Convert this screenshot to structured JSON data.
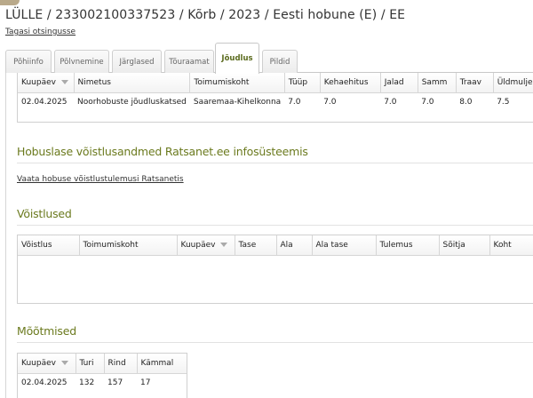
{
  "header": {
    "title": "LÜLLE / 233002100337523 / Kõrb / 2023 / Eesti hobune (E) / EE",
    "back_link": "Tagasi otsingusse"
  },
  "tabs": [
    {
      "label": "Põhiinfo",
      "active": false
    },
    {
      "label": "Põlvnemine",
      "active": false
    },
    {
      "label": "Järglased",
      "active": false
    },
    {
      "label": "Tõuraamat",
      "active": false
    },
    {
      "label": "Jõudlus",
      "active": true
    },
    {
      "label": "Pildid",
      "active": false
    }
  ],
  "performance": {
    "columns": [
      "Kuupäev",
      "Nimetus",
      "Toimumiskoht",
      "Tüüp",
      "Kehaehitus",
      "Jalad",
      "Samm",
      "Traav",
      "Üldmulje"
    ],
    "rows": [
      [
        "02.04.2025",
        "Noorhobuste jõudluskatsed",
        "Saaremaa-Kihelkonna",
        "7.0",
        "7.0",
        "7.0",
        "7.0",
        "8.0",
        "7.5"
      ]
    ]
  },
  "ratsanet": {
    "title": "Hobuslase võistlusandmed Ratsanet.ee infosüsteemis",
    "link": "Vaata hobuse võistlustulemusi Ratsanetis"
  },
  "competitions": {
    "title": "Võistlused",
    "columns": [
      "Võistlus",
      "Toimumiskoht",
      "Kuupäev",
      "Tase",
      "Ala",
      "Ala tase",
      "Tulemus",
      "Sõitja",
      "Koht"
    ]
  },
  "measurements": {
    "title": "Mõõtmised",
    "columns": [
      "Kuupäev",
      "Turi",
      "Rind",
      "Kämmal"
    ],
    "rows": [
      [
        "02.04.2025",
        "132",
        "157",
        "17"
      ]
    ]
  },
  "colors": {
    "accent": "#6b7a1e",
    "active_tab_text": "#5b6b1e"
  }
}
